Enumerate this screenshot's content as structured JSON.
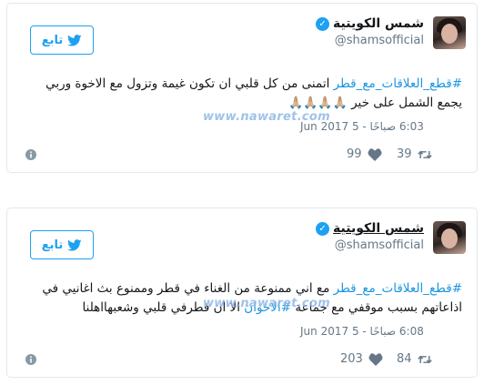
{
  "tweets": [
    {
      "display_name": "شمس الكويتية",
      "handle": "@shamsofficial",
      "follow_label": "تابع",
      "hashtag": "#قطع_العلاقات_مع_قطر",
      "text_main": " اتمنى من كل قلبي ان تكون غيمة وتزول مع الاخوة وربي يجمع الشمل على خير ",
      "emojis": "🙏🏼🙏🏼🙏🏼🙏🏼",
      "watermark": "www.nawaret.com",
      "timestamp": "6:03 صباحًا - 5 Jun 2017",
      "retweets": "39",
      "likes": "99"
    },
    {
      "display_name": "شمس الكويتية",
      "handle": "@shamsofficial",
      "follow_label": "تابع",
      "hashtag": "#قطع_العلاقات_مع_قطر",
      "text_main": " مع اني ممنوعة من الغناء في قطر وممنوع بث اغانيي في اذاعاتهم بسبب موقفي مع جماعة ",
      "hashtag2": "#الاخوان",
      "text_tail": " الا ان قطرفي قلبي وشعبهااهلنا",
      "watermark": "www.nawaret.com",
      "timestamp": "6:08 صباحًا - 5 Jun 2017",
      "retweets": "84",
      "likes": "203"
    }
  ],
  "icons": {
    "verified": "verified-badge-icon",
    "bird": "twitter-bird-icon",
    "retweet": "retweet-icon",
    "like": "heart-icon",
    "info": "info-icon"
  },
  "colors": {
    "twitter_blue": "#1da1f2",
    "hashtag": "#1b95e0",
    "muted": "#657786",
    "border": "#e1e8ed"
  }
}
